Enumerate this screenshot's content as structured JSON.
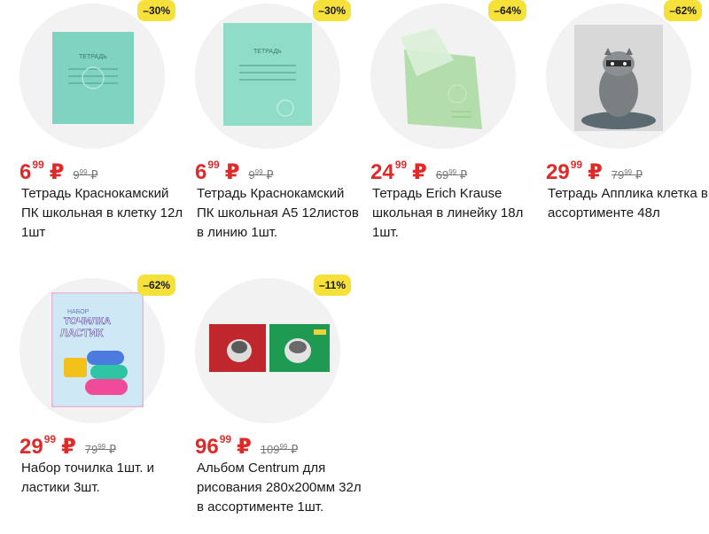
{
  "products": [
    {
      "discount": "–30%",
      "price_int": "6",
      "price_dec": "99",
      "currency": "₽",
      "old_int": "9",
      "old_dec": "99",
      "old_currency": "₽",
      "title": "Тетрадь Краснокамский ПК школьная в клетку 12л 1шт",
      "cover_text": "ТЕТРАДЬ"
    },
    {
      "discount": "–30%",
      "price_int": "6",
      "price_dec": "99",
      "currency": "₽",
      "old_int": "9",
      "old_dec": "99",
      "old_currency": "₽",
      "title": "Тетрадь Краснокамский ПК школьная А5 12листов в линию 1шт.",
      "cover_text": "ТЕТРАДЬ"
    },
    {
      "discount": "–64%",
      "price_int": "24",
      "price_dec": "99",
      "currency": "₽",
      "old_int": "69",
      "old_dec": "99",
      "old_currency": "₽",
      "title": "Тетрадь Erich Krause школьная в линейку 18л 1шт."
    },
    {
      "discount": "–62%",
      "price_int": "29",
      "price_dec": "99",
      "currency": "₽",
      "old_int": "79",
      "old_dec": "99",
      "old_currency": "₽",
      "title": "Тетрадь Апплика клетка в ассортименте 48л"
    },
    {
      "discount": "–62%",
      "price_int": "29",
      "price_dec": "99",
      "currency": "₽",
      "old_int": "79",
      "old_dec": "99",
      "old_currency": "₽",
      "title": "Набор точилка 1шт. и ластики 3шт.",
      "pack_text_top": "НАБОР",
      "pack_text_1": "ТОЧИЛКА",
      "pack_text_2": "ЛАСТИК"
    },
    {
      "discount": "–11%",
      "price_int": "96",
      "price_dec": "99",
      "currency": "₽",
      "old_int": "109",
      "old_dec": "99",
      "old_currency": "₽",
      "title": "Альбом Centrum для рисования 280х200мм 32л в ассортименте 1шт."
    }
  ],
  "colors": {
    "accent_red": "#e02a2a",
    "badge_yellow": "#f6e03a",
    "card_bg": "#f2f2f2"
  }
}
